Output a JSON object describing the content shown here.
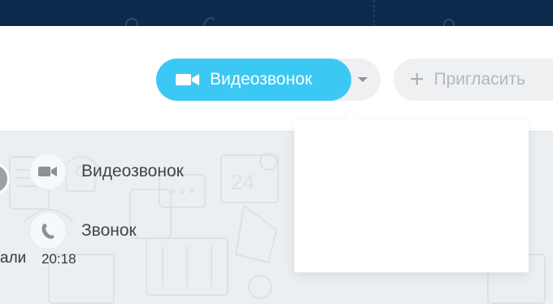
{
  "header": {
    "video_call_label": "Видеозвонок",
    "invite_label": "Пригласить",
    "invite_icon": "plus-icon",
    "video_icon": "camera-icon",
    "dropdown_icon": "caret-down-icon"
  },
  "dropdown_menu": {
    "items": [
      {
        "label": "Видеозвонок",
        "icon": "camera-icon"
      },
      {
        "label": "Звонок",
        "icon": "phone-icon"
      }
    ]
  },
  "chat": {
    "message_author_fragment": "али",
    "message_time": "20:18"
  },
  "colors": {
    "topbar": "#0d2a4d",
    "accent": "#3bc8f5",
    "chat_bg": "#eceff2",
    "pill_bg": "#eef0f2"
  }
}
